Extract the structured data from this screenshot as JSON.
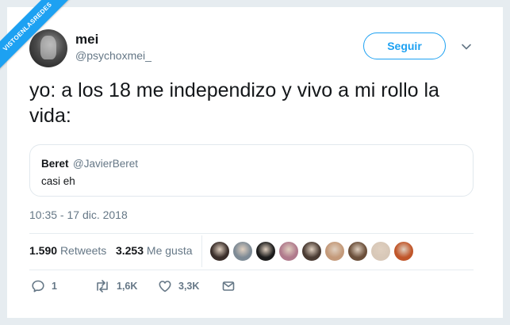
{
  "watermark": "VISTOENLASREDES",
  "author": {
    "name": "mei",
    "handle": "@psychoxmei_"
  },
  "follow_label": "Seguir",
  "tweet_text": "yo: a los 18 me independizo y vivo a mi rollo la vida:",
  "quoted": {
    "name": "Beret",
    "handle": "@JavierBeret",
    "text": "casi eh"
  },
  "timestamp": "10:35 - 17 dic. 2018",
  "stats": {
    "retweets_count": "1.590",
    "retweets_label": "Retweets",
    "likes_count": "3.253",
    "likes_label": "Me gusta"
  },
  "liker_avatars": [
    "#3a2e2a",
    "#7d8a95",
    "#1c1c1c",
    "#b07a8c",
    "#4a3b33",
    "#c49a7a",
    "#6b4f3a",
    "#d8c8b8",
    "#c0562a"
  ],
  "actions": {
    "reply_count": "1",
    "retweet_count": "1,6K",
    "like_count": "3,3K"
  },
  "colors": {
    "accent": "#1da1f2",
    "secondary_text": "#657786",
    "border": "#e6ecf0"
  }
}
